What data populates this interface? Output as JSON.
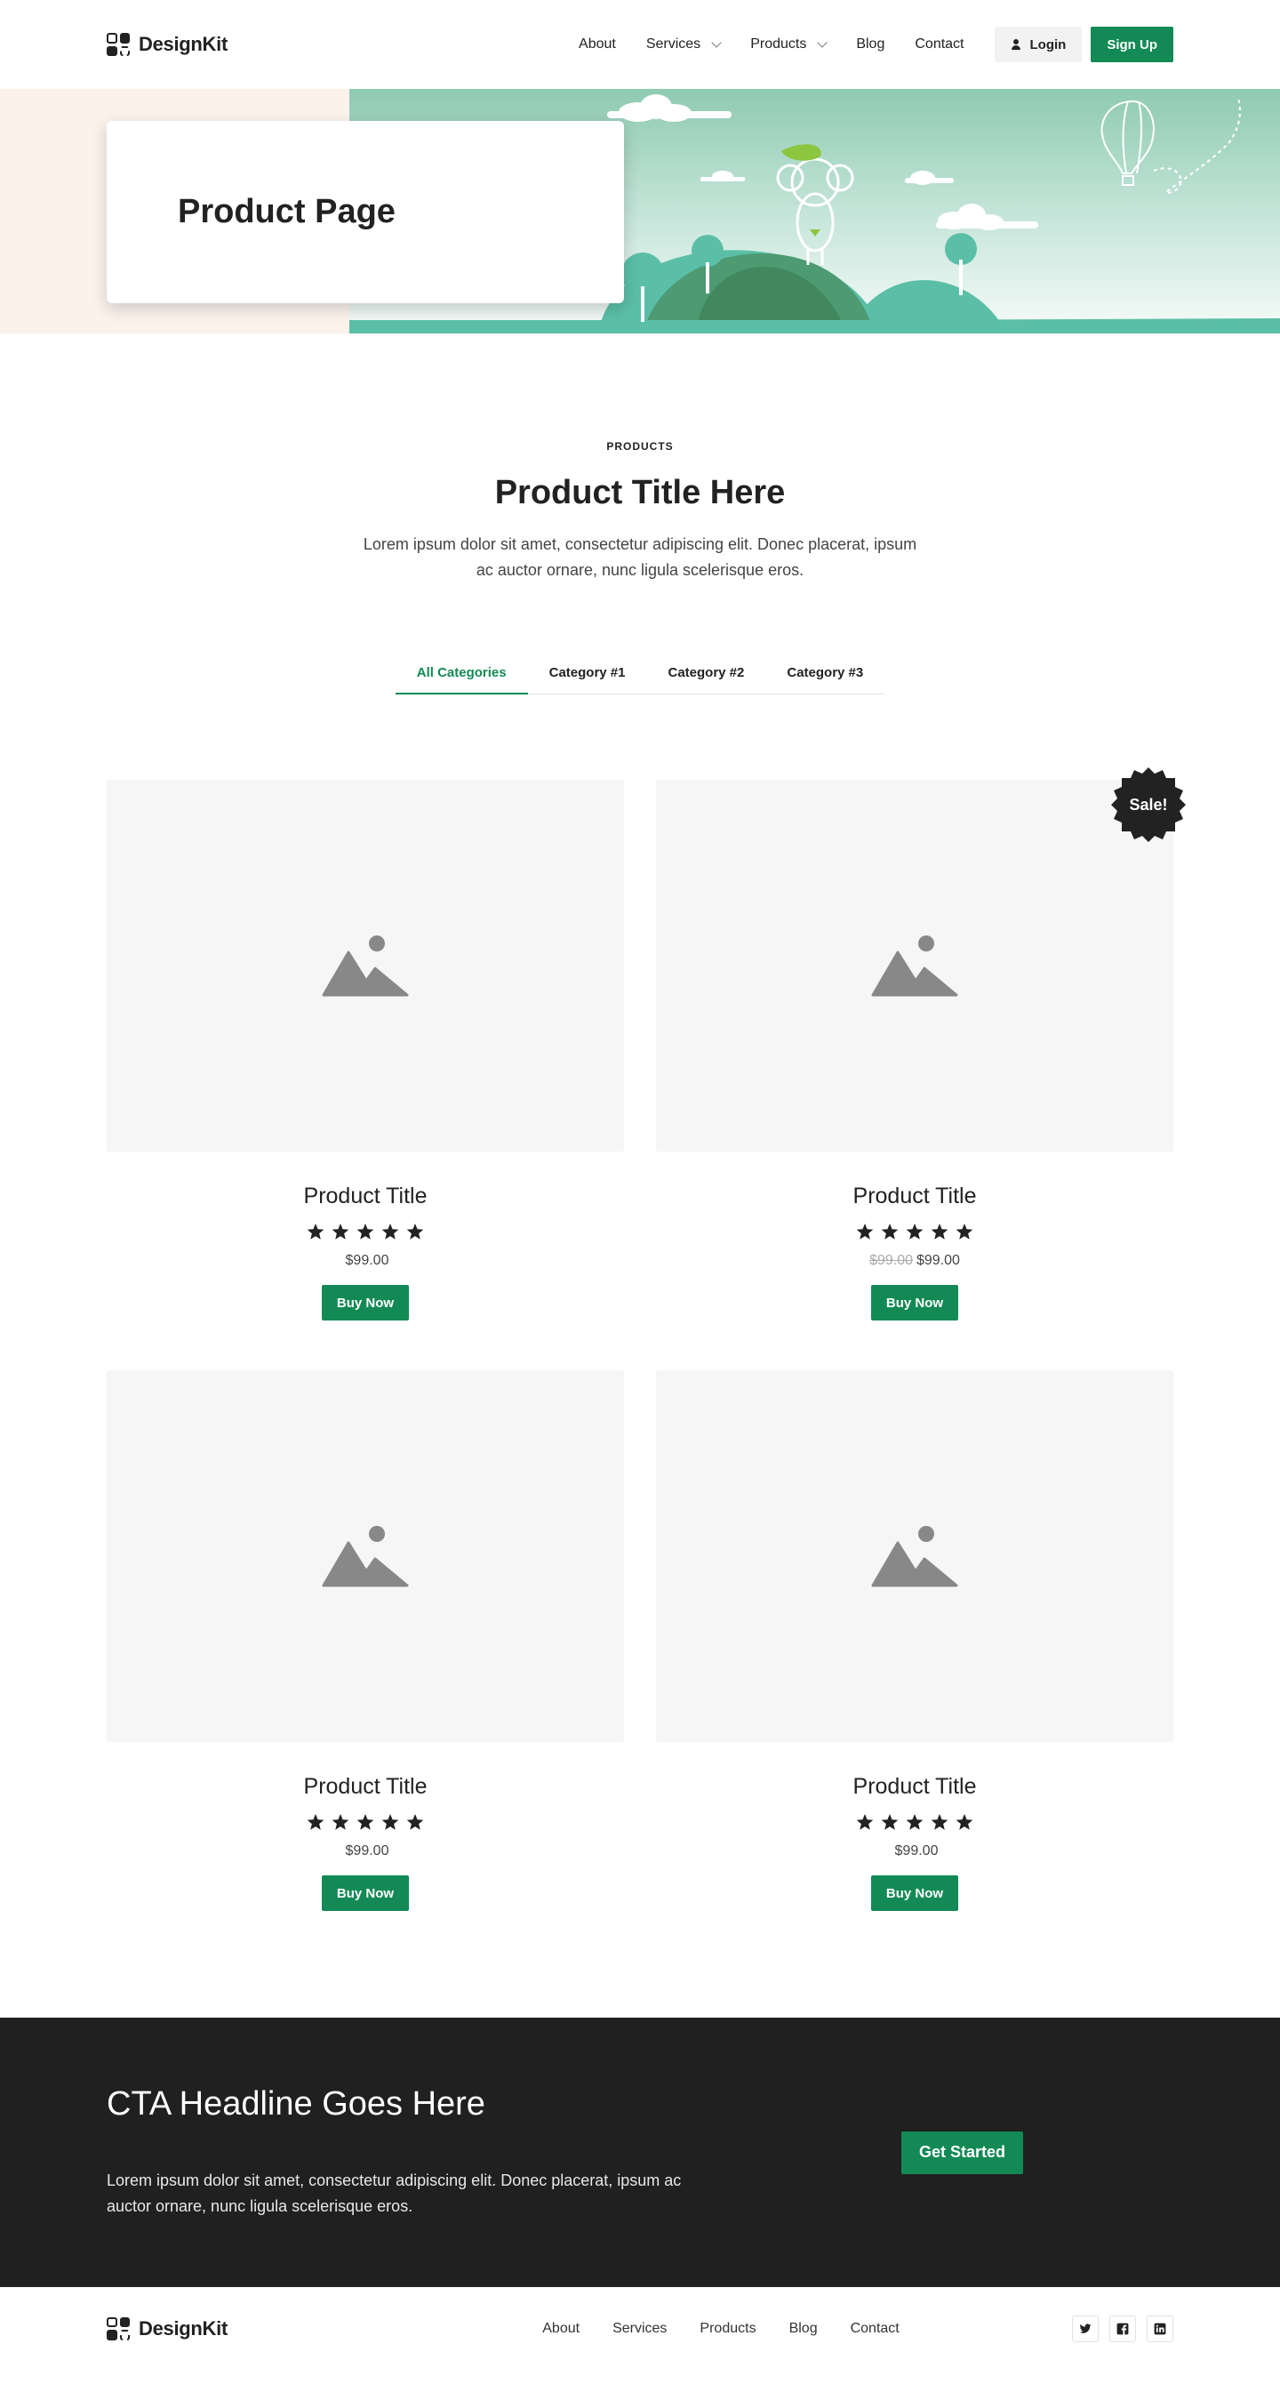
{
  "brand": {
    "name": "DesignKit"
  },
  "nav": {
    "items": [
      {
        "label": "About",
        "dropdown": false
      },
      {
        "label": "Services",
        "dropdown": true
      },
      {
        "label": "Products",
        "dropdown": true
      },
      {
        "label": "Blog",
        "dropdown": false
      },
      {
        "label": "Contact",
        "dropdown": false
      }
    ],
    "login_label": "Login",
    "signup_label": "Sign Up"
  },
  "hero": {
    "title": "Product Page"
  },
  "intro": {
    "eyebrow": "PRODUCTS",
    "title": "Product Title Here",
    "description": "Lorem ipsum dolor sit amet, consectetur adipiscing elit. Donec placerat, ipsum ac auctor ornare, nunc ligula scelerisque eros."
  },
  "tabs": [
    {
      "label": "All Categories",
      "active": true
    },
    {
      "label": "Category #1",
      "active": false
    },
    {
      "label": "Category #2",
      "active": false
    },
    {
      "label": "Category #3",
      "active": false
    }
  ],
  "products": [
    {
      "title": "Product Title",
      "rating": 5,
      "price": "$99.00",
      "old_price": "",
      "sale_badge": "",
      "button": "Buy Now"
    },
    {
      "title": "Product Title",
      "rating": 5,
      "price": "$99.00",
      "old_price": "$99.00",
      "sale_badge": "Sale!",
      "button": "Buy Now"
    },
    {
      "title": "Product Title",
      "rating": 5,
      "price": "$99.00",
      "old_price": "",
      "sale_badge": "",
      "button": "Buy Now"
    },
    {
      "title": "Product Title",
      "rating": 5,
      "price": "$99.00",
      "old_price": "",
      "sale_badge": "",
      "button": "Buy Now"
    }
  ],
  "cta": {
    "title": "CTA Headline Goes Here",
    "text": "Lorem ipsum dolor sit amet, consectetur adipiscing elit. Donec placerat, ipsum ac auctor ornare, nunc ligula scelerisque eros.",
    "button": "Get Started"
  },
  "footer": {
    "brand": "DesignKit",
    "links": [
      "About",
      "Services",
      "Products",
      "Blog",
      "Contact"
    ],
    "socials": [
      "twitter-icon",
      "facebook-icon",
      "linkedin-icon"
    ]
  },
  "colors": {
    "accent": "#138a55",
    "dark": "#202020",
    "hero_bg": "#fbf2ec",
    "image_placeholder": "#f6f6f6"
  }
}
